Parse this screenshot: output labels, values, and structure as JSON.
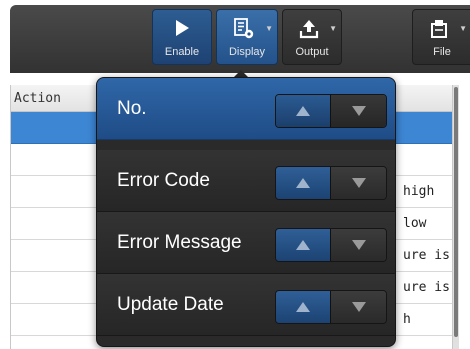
{
  "toolbar": {
    "buttons": [
      {
        "label": "Enable",
        "icon": "play-icon"
      },
      {
        "label": "Display",
        "icon": "display-settings-icon",
        "has_menu": true
      },
      {
        "label": "Output",
        "icon": "export-icon",
        "has_menu": true
      },
      {
        "label": "File",
        "icon": "file-icon",
        "has_menu": true
      }
    ]
  },
  "table": {
    "column_header": "Action",
    "rows": [
      {
        "text": "",
        "selected": true
      },
      {
        "text": ""
      },
      {
        "text": "high"
      },
      {
        "text": "low"
      },
      {
        "text": "ure is"
      },
      {
        "text": "ure is"
      },
      {
        "text": "h"
      }
    ]
  },
  "display_menu": {
    "items": [
      {
        "label": "No.",
        "selected": true
      },
      {
        "label": "Error Code"
      },
      {
        "label": "Error Message"
      },
      {
        "label": "Update Date"
      }
    ],
    "sort_ascending_icon": "triangle-up-icon",
    "sort_descending_icon": "triangle-down-icon"
  },
  "colors": {
    "accent": "#2f67a8",
    "selection": "#3d86d4",
    "toolbar": "#3a3a3a",
    "menu_bg": "#2a2a2a"
  }
}
